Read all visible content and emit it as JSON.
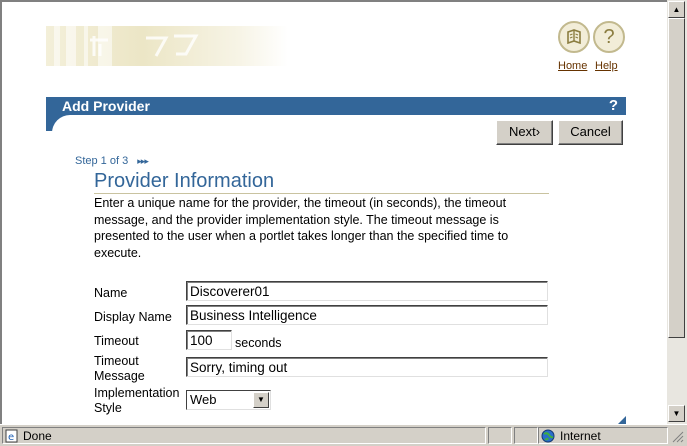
{
  "header": {
    "home_label": "Home",
    "help_label": "Help",
    "home_icon": "home-book-icon",
    "help_icon": "question-icon",
    "help_glyph": "?"
  },
  "titlebar": {
    "title": "Add Provider",
    "help_glyph": "?",
    "color": "#336699"
  },
  "buttons": {
    "next_label": "Next",
    "next_glyph": "›",
    "cancel_label": "Cancel"
  },
  "wizard": {
    "step_text": "Step 1 of 3",
    "step_arrows": "▸▸▸"
  },
  "section": {
    "title": "Provider Information",
    "description": "Enter a unique name for the provider, the timeout (in seconds), the timeout message, and the provider implementation style. The timeout message is presented to the user when a portlet takes longer than the specified time to execute."
  },
  "form": {
    "name_label": "Name",
    "name_value": "Discoverer01",
    "display_name_label": "Display Name",
    "display_name_value": "Business Intelligence",
    "timeout_label": "Timeout",
    "timeout_value": "100",
    "timeout_unit": "seconds",
    "timeout_message_label_1": "Timeout",
    "timeout_message_label_2": "Message",
    "timeout_message_value": "Sorry, timing out",
    "style_label_1": "Implementation",
    "style_label_2": "Style",
    "style_value": "Web"
  },
  "statusbar": {
    "status_text": "Done",
    "zone_text": "Internet"
  }
}
